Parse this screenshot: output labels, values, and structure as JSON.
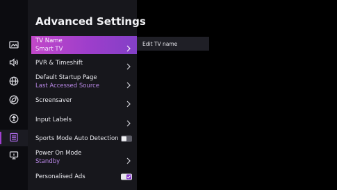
{
  "panel": {
    "title": "Advanced Settings"
  },
  "rail": {
    "items": [
      {
        "icon": "picture-icon"
      },
      {
        "icon": "sound-icon"
      },
      {
        "icon": "network-icon"
      },
      {
        "icon": "eco-icon"
      },
      {
        "icon": "accessibility-icon"
      },
      {
        "icon": "general-settings-icon"
      },
      {
        "icon": "system-icon"
      }
    ],
    "active_index": 5,
    "accent_color": "#a03fd0"
  },
  "settings": {
    "tv_name": {
      "label": "TV Name",
      "value": "Smart TV"
    },
    "pvr": {
      "label": "PVR & Timeshift"
    },
    "startup": {
      "label": "Default Startup Page",
      "value": "Last Accessed Source"
    },
    "screensaver": {
      "label": "Screensaver"
    },
    "input_labels": {
      "label": "Input Labels"
    },
    "sports_mode": {
      "label": "Sports Mode Auto Detection",
      "enabled": false
    },
    "power_on": {
      "label": "Power On Mode",
      "value": "Standby"
    },
    "personalised_ads": {
      "label": "Personalised Ads",
      "enabled": true
    }
  },
  "submenu": {
    "item": "Edit TV name"
  },
  "colors": {
    "highlight_start": "#c248c9",
    "highlight_end": "#8340c7",
    "value_text": "#b987e6"
  }
}
